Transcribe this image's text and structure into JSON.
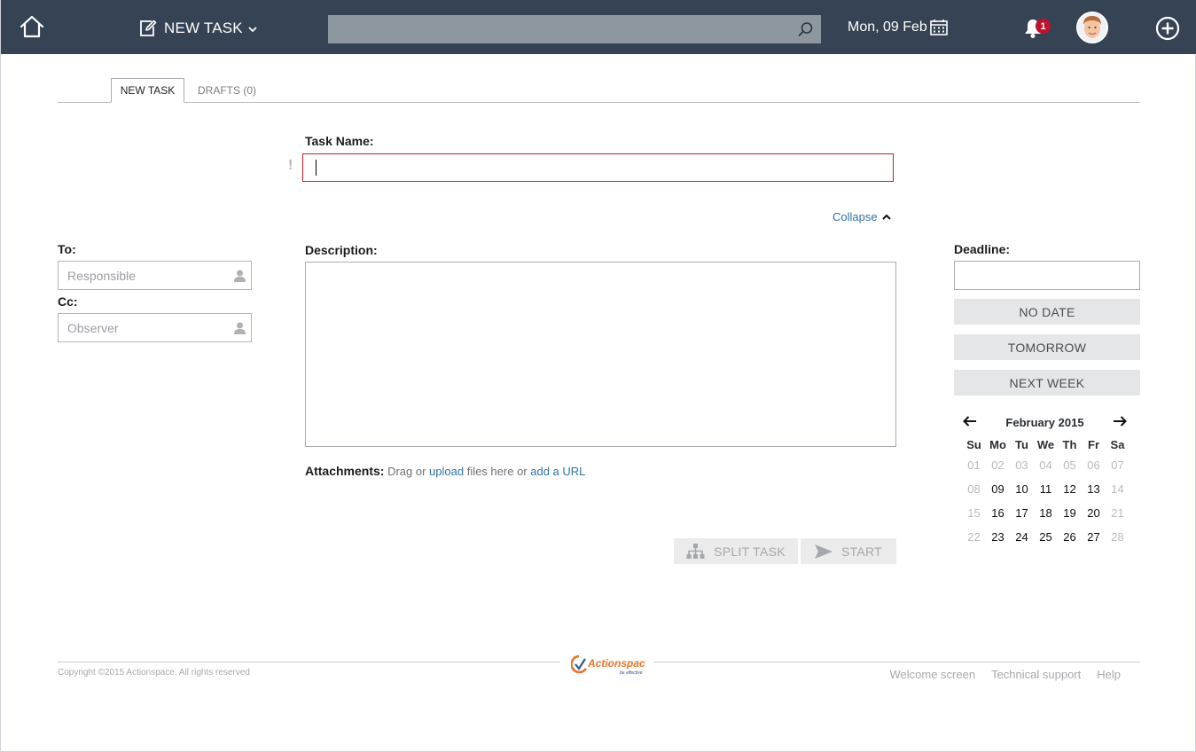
{
  "header": {
    "new_task_label": "NEW TASK",
    "search_placeholder": "",
    "date": "Mon, 09 Feb",
    "notification_count": "1",
    "icons": [
      "home-icon",
      "edit-icon",
      "chevron-down-icon",
      "search-icon",
      "calendar-icon",
      "bell-icon",
      "avatar",
      "plus-circle-icon"
    ],
    "colors": {
      "bar": "#354354",
      "search_bg": "#8e969f",
      "badge": "#c0112d"
    }
  },
  "tabs": [
    {
      "label": "NEW TASK",
      "active": true
    },
    {
      "label": "DRAFTS (0)",
      "active": false
    }
  ],
  "form": {
    "task_name_label": "Task Name:",
    "task_name_value": "",
    "required_mark": "!",
    "collapse_label": "Collapse",
    "to_label": "To:",
    "to_placeholder": "Responsible",
    "cc_label": "Cc:",
    "cc_placeholder": "Observer",
    "description_label": "Description:",
    "description_value": "",
    "attachments": {
      "label": "Attachments:",
      "text_1": " Drag or ",
      "link_upload": "upload",
      "text_2": " files here or ",
      "link_url": "add a URL"
    },
    "split_task_label": "SPLIT TASK",
    "start_label": "START",
    "colors": {
      "link": "#2f72a8",
      "required_border": "#c81e2a"
    }
  },
  "deadline": {
    "label": "Deadline:",
    "value": "",
    "quick_options": [
      "NO DATE",
      "TOMORROW",
      "NEXT WEEK"
    ],
    "calendar": {
      "month": "February 2015",
      "weekdays": [
        "Su",
        "Mo",
        "Tu",
        "We",
        "Th",
        "Fr",
        "Sa"
      ],
      "weeks": [
        [
          {
            "d": "01",
            "muted": true
          },
          {
            "d": "02",
            "muted": true
          },
          {
            "d": "03",
            "muted": true
          },
          {
            "d": "04",
            "muted": true
          },
          {
            "d": "05",
            "muted": true
          },
          {
            "d": "06",
            "muted": true
          },
          {
            "d": "07",
            "muted": true
          }
        ],
        [
          {
            "d": "08",
            "muted": true
          },
          {
            "d": "09",
            "muted": false
          },
          {
            "d": "10",
            "muted": false
          },
          {
            "d": "11",
            "muted": false
          },
          {
            "d": "12",
            "muted": false
          },
          {
            "d": "13",
            "muted": false
          },
          {
            "d": "14",
            "muted": true
          }
        ],
        [
          {
            "d": "15",
            "muted": true
          },
          {
            "d": "16",
            "muted": false
          },
          {
            "d": "17",
            "muted": false
          },
          {
            "d": "18",
            "muted": false
          },
          {
            "d": "19",
            "muted": false
          },
          {
            "d": "20",
            "muted": false
          },
          {
            "d": "21",
            "muted": true
          }
        ],
        [
          {
            "d": "22",
            "muted": true
          },
          {
            "d": "23",
            "muted": false
          },
          {
            "d": "24",
            "muted": false
          },
          {
            "d": "25",
            "muted": false
          },
          {
            "d": "26",
            "muted": false
          },
          {
            "d": "27",
            "muted": false
          },
          {
            "d": "28",
            "muted": true
          }
        ]
      ]
    }
  },
  "footer": {
    "copyright": "Copyright ©2015 Actionspace. All rights reserved",
    "logo_text": "Actionspace",
    "logo_tagline": "be effective",
    "links": [
      "Welcome screen",
      "Technical support",
      "Help"
    ],
    "colors": {
      "logo_orange": "#e8742a",
      "logo_blue": "#2a5a8c"
    }
  }
}
